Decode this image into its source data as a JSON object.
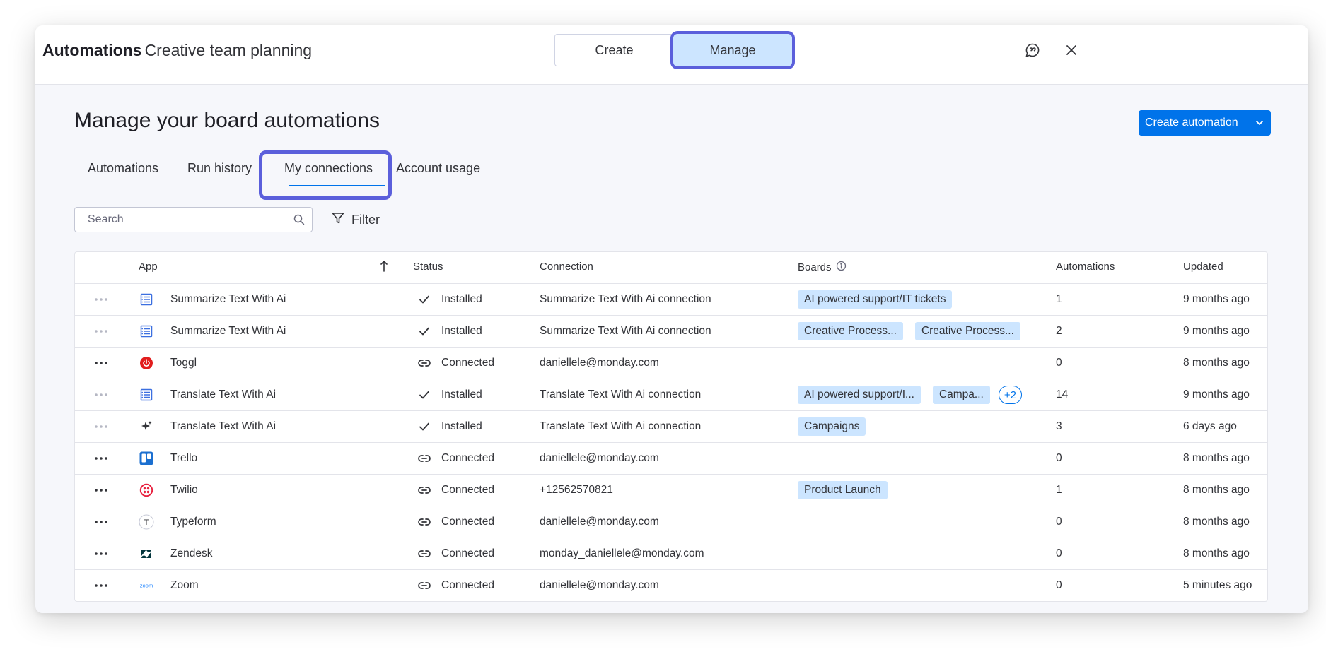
{
  "header": {
    "brand": "Automations",
    "subtitle": "Creative team planning",
    "segments": {
      "create": "Create",
      "manage": "Manage"
    }
  },
  "page": {
    "title": "Manage your board automations",
    "create_button": "Create automation"
  },
  "tabs": [
    {
      "label": "Automations"
    },
    {
      "label": "Run history"
    },
    {
      "label": "My connections"
    },
    {
      "label": "Account usage"
    }
  ],
  "toolbar": {
    "search_placeholder": "Search",
    "filter_label": "Filter"
  },
  "table": {
    "columns": {
      "app": "App",
      "status": "Status",
      "connection": "Connection",
      "boards": "Boards",
      "automations": "Automations",
      "updated": "Updated"
    },
    "rows": [
      {
        "icon": "list-icon",
        "app": "Summarize Text With Ai",
        "status_icon": "check-icon",
        "status": "Installed",
        "connection": "Summarize Text With Ai connection",
        "boards": [
          "AI powered support/IT tickets"
        ],
        "more": "",
        "automations": "1",
        "updated": "9 months ago"
      },
      {
        "icon": "list-icon",
        "app": "Summarize Text With Ai",
        "status_icon": "check-icon",
        "status": "Installed",
        "connection": "Summarize Text With Ai connection",
        "boards": [
          "Creative Process...",
          "Creative Process..."
        ],
        "more": "",
        "automations": "2",
        "updated": "9 months ago"
      },
      {
        "icon": "toggl-icon",
        "app": "Toggl",
        "status_icon": "link-icon",
        "status": "Connected",
        "connection": "daniellele@monday.com",
        "boards": [],
        "more": "",
        "automations": "0",
        "updated": "8 months ago"
      },
      {
        "icon": "list-icon",
        "app": "Translate Text With Ai",
        "status_icon": "check-icon",
        "status": "Installed",
        "connection": "Translate Text With Ai connection",
        "boards": [
          "AI powered support/I...",
          "Campa..."
        ],
        "more": "+2",
        "automations": "14",
        "updated": "9 months ago"
      },
      {
        "icon": "sparkle-icon",
        "app": "Translate Text With Ai",
        "status_icon": "check-icon",
        "status": "Installed",
        "connection": "Translate Text With Ai connection",
        "boards": [
          "Campaigns"
        ],
        "more": "",
        "automations": "3",
        "updated": "6 days ago"
      },
      {
        "icon": "trello-icon",
        "app": "Trello",
        "status_icon": "link-icon",
        "status": "Connected",
        "connection": "daniellele@monday.com",
        "boards": [],
        "more": "",
        "automations": "0",
        "updated": "8 months ago"
      },
      {
        "icon": "twilio-icon",
        "app": "Twilio",
        "status_icon": "link-icon",
        "status": "Connected",
        "connection": "+12562570821",
        "boards": [
          "Product Launch"
        ],
        "more": "",
        "automations": "1",
        "updated": "8 months ago"
      },
      {
        "icon": "typeform-icon",
        "app": "Typeform",
        "status_icon": "link-icon",
        "status": "Connected",
        "connection": "daniellele@monday.com",
        "boards": [],
        "more": "",
        "automations": "0",
        "updated": "8 months ago"
      },
      {
        "icon": "zendesk-icon",
        "app": "Zendesk",
        "status_icon": "link-icon",
        "status": "Connected",
        "connection": "monday_daniellele@monday.com",
        "boards": [],
        "more": "",
        "automations": "0",
        "updated": "8 months ago"
      },
      {
        "icon": "zoom-icon",
        "app": "Zoom",
        "status_icon": "link-icon",
        "status": "Connected",
        "connection": "daniellele@monday.com",
        "boards": [],
        "more": "",
        "automations": "0",
        "updated": "5 minutes ago"
      }
    ]
  },
  "icon_text": {
    "typeform": "T",
    "zoom": "zoom"
  },
  "colors": {
    "accent": "#0073ea",
    "highlight": "#5b5fdb",
    "tag_bg": "#cce5ff"
  }
}
